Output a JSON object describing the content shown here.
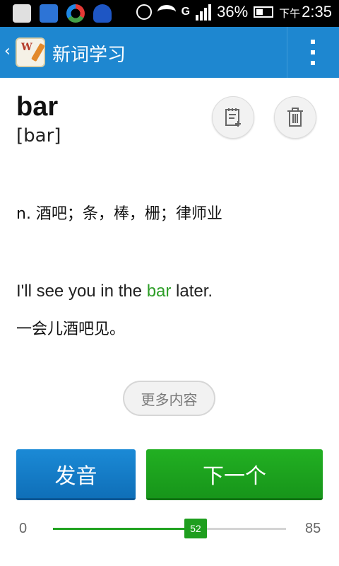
{
  "status_bar": {
    "network": "G",
    "battery_percent": "36%",
    "time_prefix": "下午",
    "time": "2:35",
    "icons": [
      "add-icon",
      "contact-icon",
      "sync-icon",
      "notification-icon",
      "alarm-icon",
      "wifi-icon",
      "signal-icon",
      "battery-icon"
    ]
  },
  "app_bar": {
    "back": "‹",
    "title": "新词学习",
    "accent": "#1e87d0"
  },
  "word": {
    "headword": "bar",
    "phonetic": "[bar]",
    "definition": "n. 酒吧；条，棒，栅；律师业",
    "example_before": "I'll see you in the ",
    "example_highlight": "bar",
    "example_after": " later.",
    "example_translation": "一会儿酒吧见。",
    "highlight_color": "#2e9e28"
  },
  "actions": {
    "more": "更多内容",
    "speak": "发音",
    "next": "下一个"
  },
  "progress": {
    "min": "0",
    "max": "85",
    "current": "52",
    "value": 52,
    "total": 85
  }
}
